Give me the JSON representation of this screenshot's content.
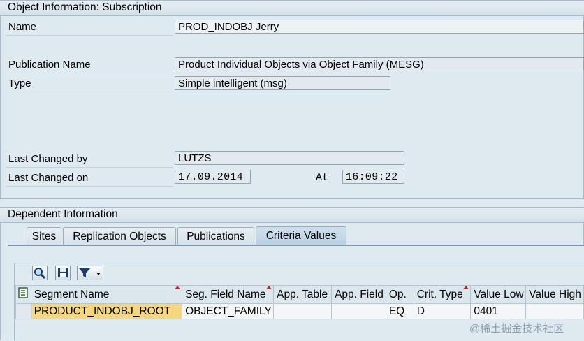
{
  "object_info": {
    "header": "Object Information: Subscription",
    "name_label": "Name",
    "name_value": "PROD_INDOBJ Jerry",
    "publication_label": "Publication Name",
    "publication_value": "Product Individual Objects via Object Family (MESG)",
    "type_label": "Type",
    "type_value": "Simple intelligent (msg)",
    "changed_by_label": "Last Changed by",
    "changed_by_value": "LUTZS",
    "changed_on_label": "Last Changed on",
    "changed_on_value": "17.09.2014",
    "at_label": "At",
    "at_value": "16:09:22"
  },
  "dependent_info": {
    "header": "Dependent Information",
    "tabs": [
      {
        "label": "Sites"
      },
      {
        "label": "Replication Objects"
      },
      {
        "label": "Publications"
      },
      {
        "label": "Criteria Values",
        "active": true
      }
    ]
  },
  "toolbar": {
    "icons": [
      "find-icon",
      "save-layout-icon",
      "filter-icon",
      "dropdown-arrow-icon"
    ]
  },
  "grid": {
    "columns": [
      "Segment Name",
      "Seg. Field Name",
      "App. Table",
      "App. Field",
      "Op.",
      "Crit. Type",
      "Value Low",
      "Value High"
    ],
    "rows": [
      [
        "PRODUCT_INDOBJ_ROOT",
        "OBJECT_FAMILY",
        "",
        "",
        "EQ",
        "D",
        "0401",
        ""
      ]
    ]
  },
  "watermark": "@稀土掘金技术社区",
  "colors": {
    "background": "#dfe9f0",
    "key_cell": "#f7d77d",
    "active_tab": "#b9d0e2",
    "sort_marker": "#d01c1c"
  }
}
